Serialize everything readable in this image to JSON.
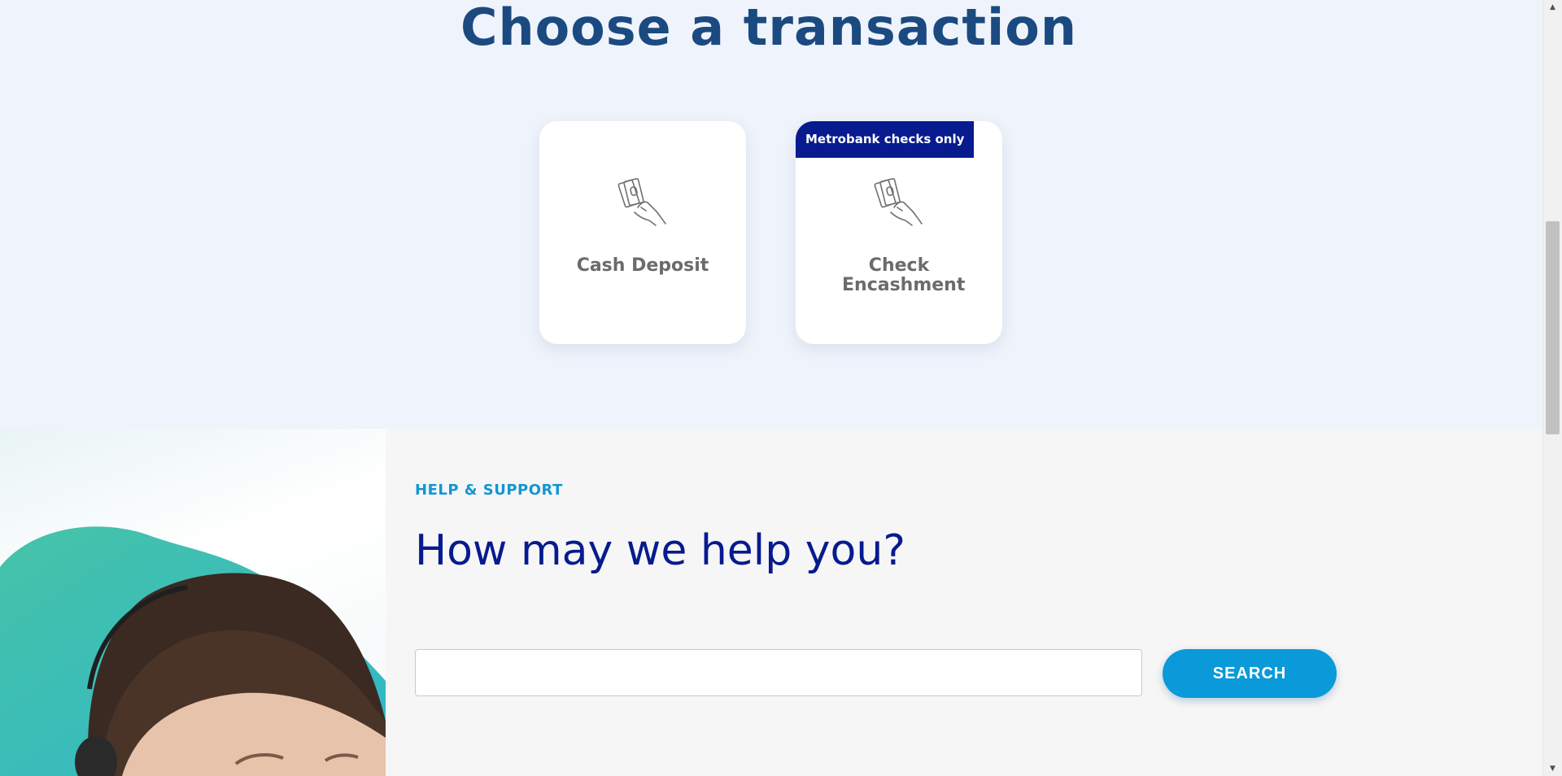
{
  "transactions": {
    "title": "Choose a transaction",
    "cards": [
      {
        "label": "Cash Deposit",
        "icon": "cash-in-hand-icon"
      },
      {
        "label": "Check Encashment",
        "icon": "cash-in-hand-icon",
        "badge": "Metrobank checks only"
      }
    ]
  },
  "help": {
    "eyebrow": "HELP & SUPPORT",
    "heading": "How may we help you?",
    "search": {
      "value": "",
      "placeholder": "",
      "button_label": "SEARCH"
    }
  },
  "colors": {
    "title": "#1a4a80",
    "badge": "#071b8f",
    "eyebrow": "#1296d3",
    "heading": "#071b8f",
    "search_button": "#0a9ad9"
  },
  "scrollbar": {
    "up_arrow": "▲",
    "down_arrow": "▼"
  }
}
